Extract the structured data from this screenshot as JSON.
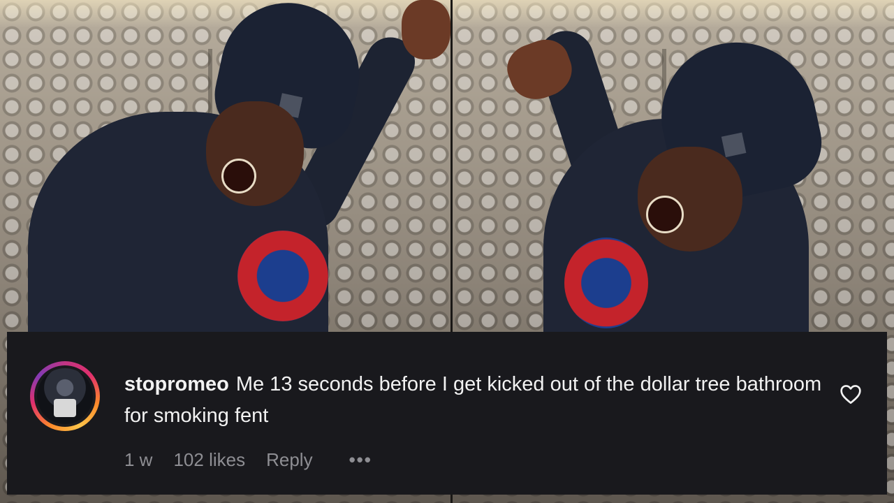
{
  "comment": {
    "username": "stopromeo",
    "text": "Me 13 seconds before I get kicked out of the dollar tree bathroom for smoking fent",
    "age": "1 w",
    "likes": "102 likes",
    "reply_label": "Reply",
    "more_label": "•••"
  },
  "icons": {
    "like": "heart-outline-icon",
    "more": "ellipsis-icon"
  },
  "colors": {
    "card_background": "#19191d",
    "text_primary": "#f2f2f2",
    "text_secondary": "#8e8e93",
    "story_ring": [
      "#c13584",
      "#e1306c",
      "#fd8a2b",
      "#fcc44a",
      "#833ab4"
    ]
  }
}
